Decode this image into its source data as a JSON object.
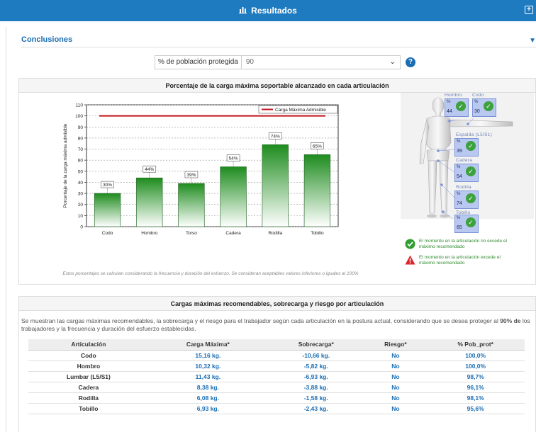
{
  "window": {
    "title": "Resultados",
    "title_icon": "bar-chart-icon"
  },
  "section": {
    "label": "Conclusiones"
  },
  "population": {
    "label": "% de población protegida",
    "value": "90"
  },
  "chart_panel": {
    "title": "Porcentaje de la carga máxima soportable alcanzado en cada articulación",
    "note": "Estos porcentajes se calculan considerando la frecuencia y duración del esfuerzo. Se consideran aceptables valores inferiores o iguales al 100%"
  },
  "chart_data": {
    "type": "bar",
    "categories": [
      "Codo",
      "Hombro",
      "Torso",
      "Cadera",
      "Rodilla",
      "Tobillo"
    ],
    "values": [
      30,
      44,
      39,
      54,
      74,
      65
    ],
    "data_labels": [
      "30%",
      "44%",
      "39%",
      "54%",
      "74%",
      "65%"
    ],
    "ylabel": "Porcentaje de la carga máxima admisible",
    "xlabel": "",
    "ylim": [
      0,
      110
    ],
    "yticks": [
      0,
      10,
      20,
      30,
      40,
      50,
      60,
      70,
      80,
      90,
      100,
      110
    ],
    "reference_line": {
      "name": "Carga Máxima Admisible",
      "value": 100,
      "color": "#c0141b"
    },
    "bar_color": "#1e8c1e",
    "grid": true,
    "legend_position": "top-right"
  },
  "body_map": {
    "joints": [
      {
        "name": "Hombro",
        "value": "44"
      },
      {
        "name": "Codo",
        "value": "30"
      },
      {
        "name": "Espalda (L5/S1)",
        "value": "39"
      },
      {
        "name": "Cadera",
        "value": "54"
      },
      {
        "name": "Rodilla",
        "value": "74"
      },
      {
        "name": "Tobillo",
        "value": "65"
      }
    ],
    "pct_label": "%",
    "legend_ok": "El momento en la articulación no excede el máximo recomendado",
    "legend_warn": "El momento en la articulación excede el máximo recomendado"
  },
  "table_panel": {
    "title": "Cargas máximas recomendables, sobrecarga y riesgo por articulación",
    "description_pre": "Se muestran las cargas máximas recomendables, la sobrecarga y el riesgo para el trabajador según cada articulación en la postura actual, considerando que se desea proteger al ",
    "description_bold": "90% de",
    "description_post": " los trabajadores y la frecuencia y duración del esfuerzo establecidas.",
    "columns": [
      "Articulación",
      "Carga Máxima*",
      "Sobrecarga*",
      "Riesgo*",
      "% Pob_prot*"
    ],
    "rows": [
      [
        "Codo",
        "15,16 kg.",
        "-10,66 kg.",
        "No",
        "100,0%"
      ],
      [
        "Hombro",
        "10,32 kg.",
        "-5,82 kg.",
        "No",
        "100,0%"
      ],
      [
        "Lumbar (L5/S1)",
        "11,43 kg.",
        "-6,93 kg.",
        "No",
        "98,7%"
      ],
      [
        "Cadera",
        "8,38 kg.",
        "-3,88 kg.",
        "No",
        "96,1%"
      ],
      [
        "Rodilla",
        "6,08 kg.",
        "-1,58 kg.",
        "No",
        "98,1%"
      ],
      [
        "Tobillo",
        "6,93 kg.",
        "-2,43 kg.",
        "No",
        "95,6%"
      ]
    ]
  }
}
